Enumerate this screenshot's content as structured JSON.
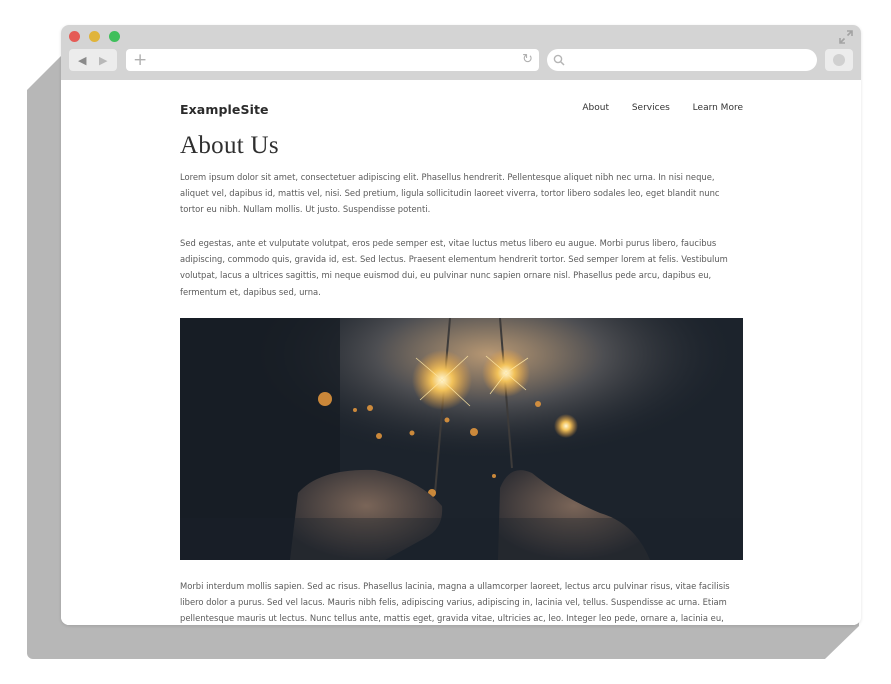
{
  "site": {
    "brand": "ExampleSite",
    "nav": [
      "About",
      "Services",
      "Learn More"
    ]
  },
  "page": {
    "title": "About Us",
    "paragraphs": [
      "Lorem ipsum dolor sit amet, consectetuer adipiscing elit. Phasellus hendrerit. Pellentesque aliquet nibh nec urna. In nisi neque, aliquet vel, dapibus id, mattis vel, nisi. Sed pretium, ligula sollicitudin laoreet viverra, tortor libero sodales leo, eget blandit nunc tortor eu nibh. Nullam mollis. Ut justo. Suspendisse potenti.",
      "Sed egestas, ante et vulputate volutpat, eros pede semper est, vitae luctus metus libero eu augue. Morbi purus libero, faucibus adipiscing, commodo quis, gravida id, est. Sed lectus. Praesent elementum hendrerit tortor. Sed semper lorem at felis. Vestibulum volutpat, lacus a ultrices sagittis, mi neque euismod dui, eu pulvinar nunc sapien ornare nisl. Phasellus pede arcu, dapibus eu, fermentum et, dapibus sed, urna.",
      "Morbi interdum mollis sapien. Sed ac risus. Phasellus lacinia, magna a ullamcorper laoreet, lectus arcu pulvinar risus, vitae facilisis libero dolor a purus. Sed vel lacus. Mauris nibh felis, adipiscing varius, adipiscing in, lacinia vel, tellus. Suspendisse ac urna. Etiam pellentesque mauris ut lectus. Nunc tellus ante, mattis eget, gravida vitae, ultricies ac, leo. Integer leo pede, ornare a, lacinia eu,"
    ]
  },
  "browser": {
    "traffic_lights": [
      "#e55b56",
      "#e0b43a",
      "#3fbf5b"
    ],
    "icons": [
      "back-arrow-icon",
      "forward-arrow-icon",
      "new-tab-plus-icon",
      "reload-icon",
      "search-icon",
      "expand-icon"
    ]
  }
}
